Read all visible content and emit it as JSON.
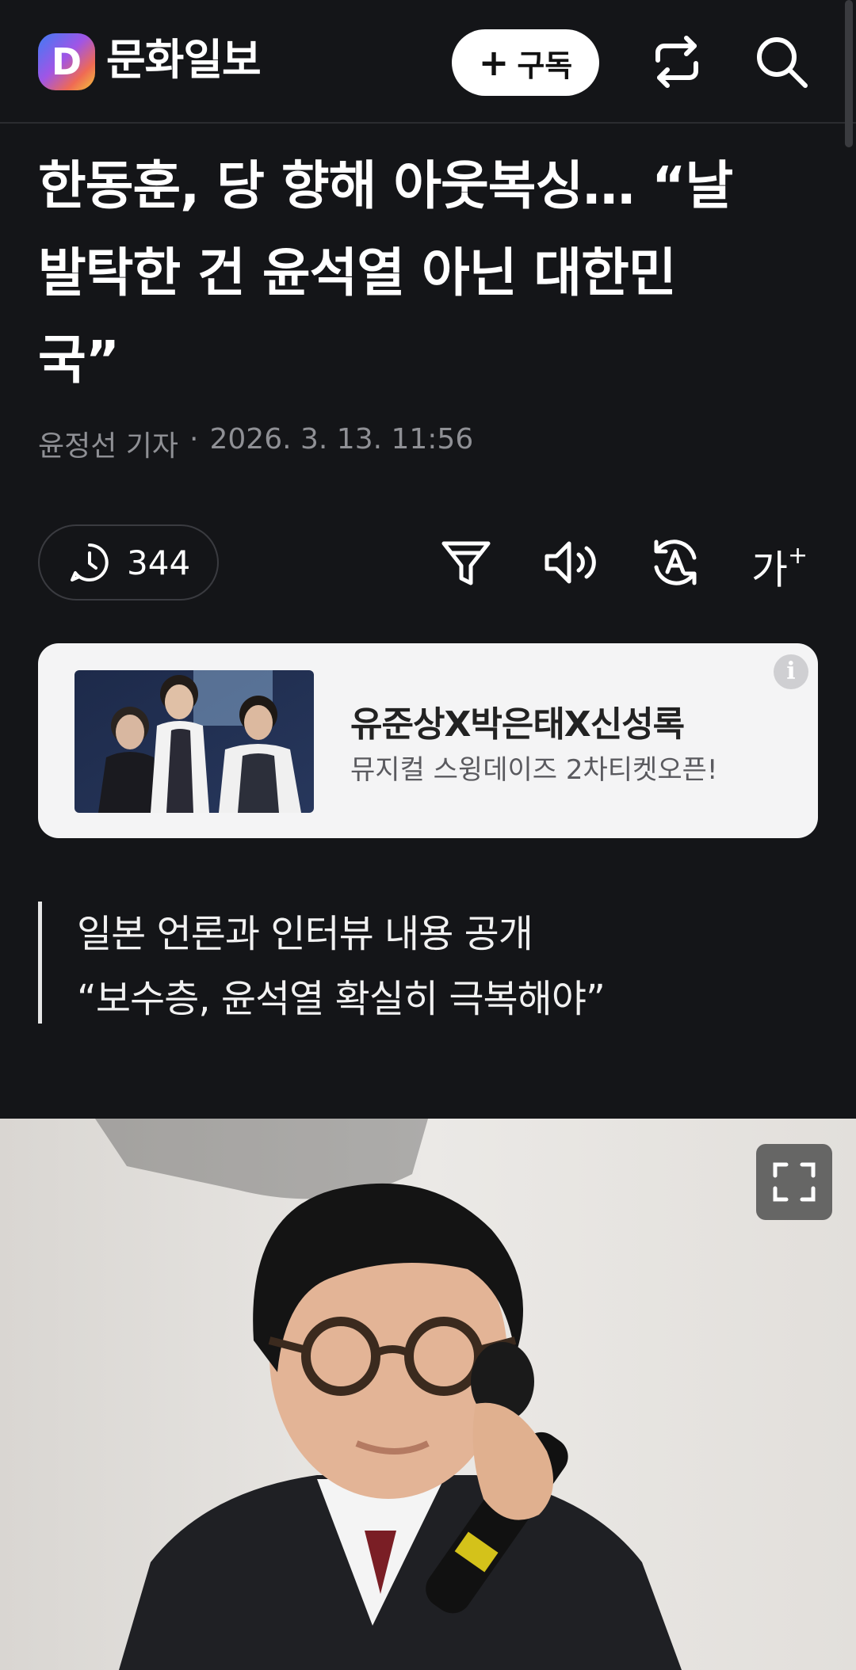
{
  "header": {
    "logo_letter": "D",
    "logo_text": "문화일보",
    "subscribe_plus": "+",
    "subscribe_label": "구독",
    "share_icon": "share-icon",
    "search_icon": "search-icon"
  },
  "article": {
    "title_lines": [
      "한동훈, 당 향해 아웃복싱… “날",
      "발탁한 건 윤석열 아닌 대한민",
      "국”"
    ],
    "author": "윤정선 기자",
    "separator": "·",
    "date": "2026. 3. 13. 11:56",
    "comment_count": "344",
    "quote_lines": [
      "일본 언론과 인터뷰 내용 공개",
      "“보수층, 윤석열 확실히 극복해야”"
    ]
  },
  "toolbar": {
    "icons": [
      "comment-icon",
      "filter-icon",
      "speaker-icon",
      "translate-icon",
      "font-size-icon"
    ],
    "font_size_label": "가",
    "font_size_plus": "+"
  },
  "ad": {
    "title": "유준상X박은태X신성록",
    "subtitle": "뮤지컬 스윙데이즈 2차티켓오픈!",
    "info_label": "i"
  },
  "colors": {
    "background": "#141518",
    "text": "#ffffff",
    "meta": "#8f9095",
    "ad_background": "#f4f4f5"
  }
}
